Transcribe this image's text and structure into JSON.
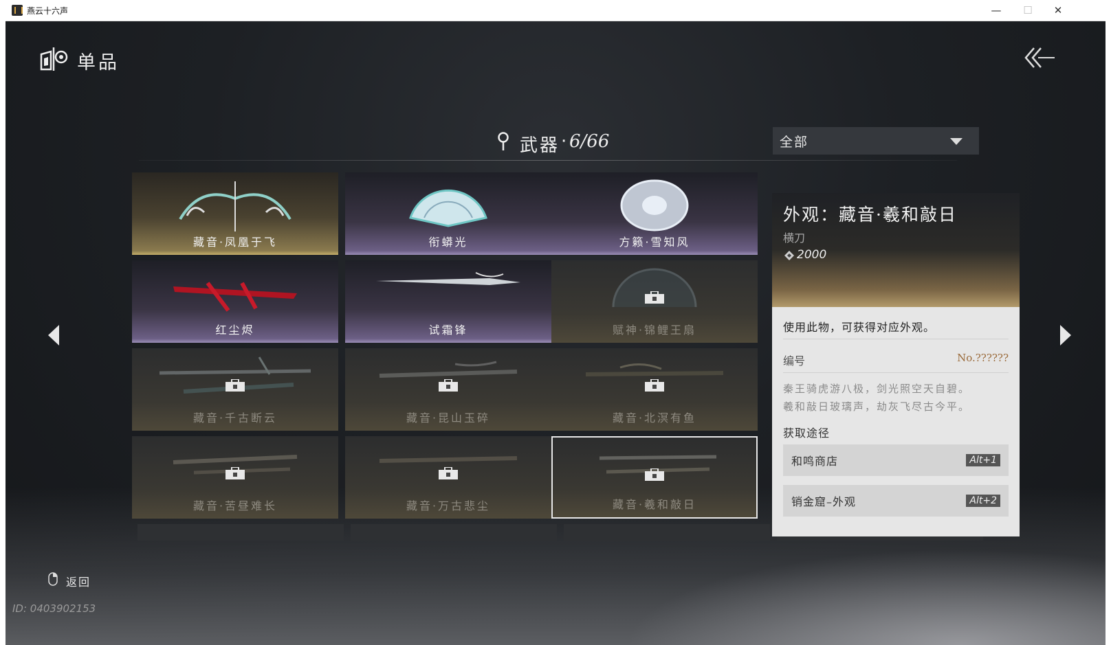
{
  "window": {
    "title": "燕云十六声",
    "minimize": "—",
    "maximize": "☐",
    "close": "✕"
  },
  "header": {
    "title": "单品"
  },
  "category": {
    "name": "武器",
    "separator": "·",
    "count": "6/66"
  },
  "filter": {
    "selected": "全部"
  },
  "items": [
    {
      "name": "藏音·凤凰于飞",
      "style": "gold",
      "locked": false
    },
    {
      "name": "衔蟒光",
      "style": "violet",
      "locked": false
    },
    {
      "name": "方籁·雪知风",
      "style": "violet",
      "locked": false
    },
    {
      "name": "红尘烬",
      "style": "violet",
      "locked": false
    },
    {
      "name": "试霜锋",
      "style": "violet",
      "locked": false
    },
    {
      "name": "赋神·锦鲤王扇",
      "style": "locked",
      "locked": true
    },
    {
      "name": "藏音·千古断云",
      "style": "locked",
      "locked": true
    },
    {
      "name": "藏音·昆山玉碎",
      "style": "locked",
      "locked": true
    },
    {
      "name": "藏音·北溟有鱼",
      "style": "locked",
      "locked": true
    },
    {
      "name": "藏音·苦昼难长",
      "style": "locked",
      "locked": true
    },
    {
      "name": "藏音·万古悲尘",
      "style": "locked",
      "locked": true
    },
    {
      "name": "藏音·羲和敲日",
      "style": "locked",
      "locked": true,
      "selected": true
    }
  ],
  "detail": {
    "title": "外观：藏音·羲和敲日",
    "type": "横刀",
    "price": "2000",
    "description": "使用此物，可获得对应外观。",
    "number_label": "编号",
    "number": "No.??????",
    "poem_line1": "秦王骑虎游八极，剑光照空天自碧。",
    "poem_line2": "羲和敲日玻璃声，劫灰飞尽古今平。",
    "source_label": "获取途径",
    "sources": [
      {
        "label": "和鸣商店",
        "key": "Alt+1"
      },
      {
        "label": "销金窟–外观",
        "key": "Alt+2"
      }
    ]
  },
  "footer": {
    "back_label": "返回",
    "player_id": "ID: 0403902153"
  },
  "colors": {
    "gold_card": "#c7b06a",
    "violet_card": "#9c8fb8",
    "detail_number": "#9a6a3a",
    "panel_bg": "#e6e6e6"
  }
}
